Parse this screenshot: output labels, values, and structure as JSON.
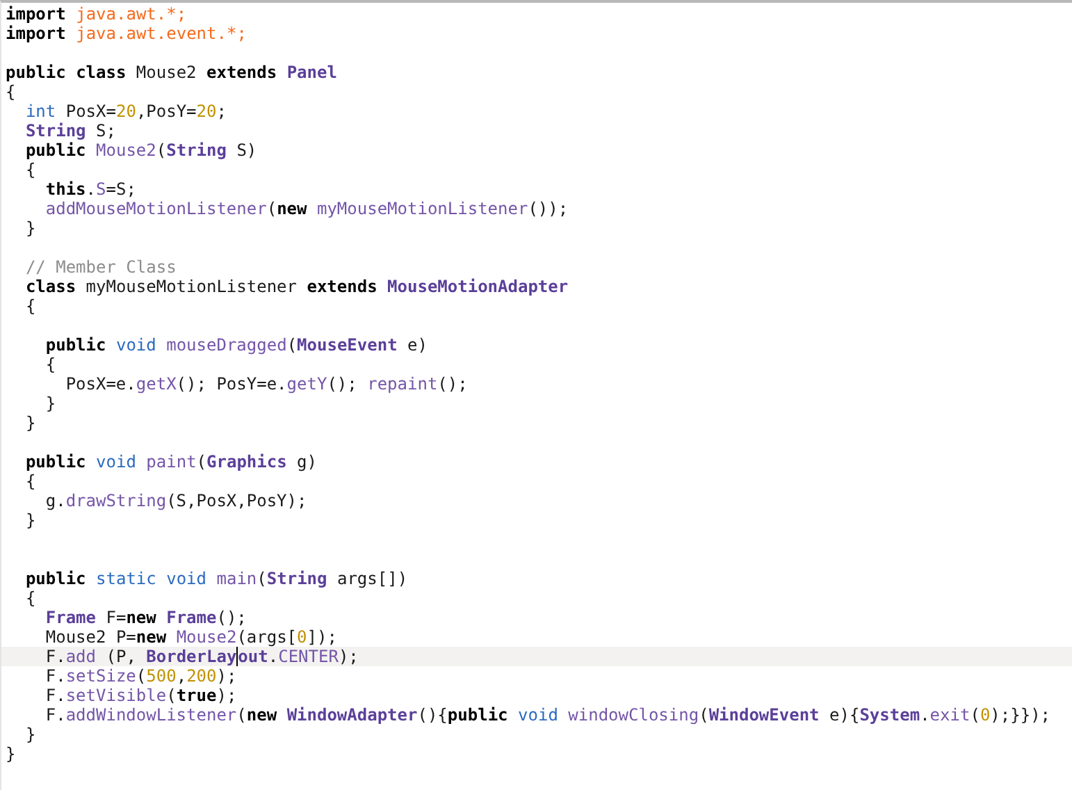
{
  "editor": {
    "lines": [
      {
        "kind": "code",
        "current": false,
        "tokens": [
          {
            "kind": "keyword",
            "text": "import"
          },
          {
            "kind": "space"
          },
          {
            "kind": "string",
            "text": "java.awt.*;"
          }
        ]
      },
      {
        "kind": "code",
        "current": false,
        "tokens": [
          {
            "kind": "keyword",
            "text": "import"
          },
          {
            "kind": "space"
          },
          {
            "kind": "string",
            "text": "java.awt.event.*;"
          }
        ]
      },
      {
        "kind": "blank",
        "current": false
      },
      {
        "kind": "code",
        "current": false,
        "tokens": [
          {
            "kind": "keyword",
            "text": "public class"
          },
          {
            "kind": "plain",
            "text": " Mouse2 "
          },
          {
            "kind": "keyword",
            "text": "extends"
          },
          {
            "kind": "space"
          },
          {
            "kind": "type",
            "text": "Panel"
          }
        ]
      },
      {
        "kind": "code",
        "current": false,
        "tokens": [
          {
            "kind": "plain",
            "text": "{"
          }
        ]
      },
      {
        "kind": "code",
        "current": false,
        "tokens": [
          {
            "kind": "indent"
          },
          {
            "kind": "primitive",
            "text": "int"
          },
          {
            "kind": "plain",
            "text": " PosX="
          },
          {
            "kind": "number",
            "text": "20"
          },
          {
            "kind": "plain",
            "text": ",PosY="
          },
          {
            "kind": "number",
            "text": "20"
          },
          {
            "kind": "plain",
            "text": ";"
          }
        ]
      },
      {
        "kind": "code",
        "current": false,
        "tokens": [
          {
            "kind": "indent"
          },
          {
            "kind": "type",
            "text": "String"
          },
          {
            "kind": "plain",
            "text": " S;"
          }
        ]
      },
      {
        "kind": "code",
        "current": false,
        "tokens": [
          {
            "kind": "indent"
          },
          {
            "kind": "keyword",
            "text": "public"
          },
          {
            "kind": "space"
          },
          {
            "kind": "function",
            "text": "Mouse2"
          },
          {
            "kind": "plain",
            "text": "("
          },
          {
            "kind": "type",
            "text": "String"
          },
          {
            "kind": "plain",
            "text": " S)"
          }
        ]
      },
      {
        "kind": "code",
        "current": false,
        "tokens": [
          {
            "kind": "indent"
          },
          {
            "kind": "plain",
            "text": "{"
          }
        ]
      },
      {
        "kind": "code",
        "current": false,
        "tokens": [
          {
            "kind": "indent"
          },
          {
            "kind": "indent"
          },
          {
            "kind": "keyword",
            "text": "this"
          },
          {
            "kind": "plain",
            "text": "."
          },
          {
            "kind": "function",
            "text": "S"
          },
          {
            "kind": "plain",
            "text": "=S;"
          }
        ]
      },
      {
        "kind": "code",
        "current": false,
        "tokens": [
          {
            "kind": "indent"
          },
          {
            "kind": "indent"
          },
          {
            "kind": "function",
            "text": "addMouseMotionListener"
          },
          {
            "kind": "plain",
            "text": "("
          },
          {
            "kind": "keyword",
            "text": "new"
          },
          {
            "kind": "space"
          },
          {
            "kind": "function",
            "text": "myMouseMotionListener"
          },
          {
            "kind": "plain",
            "text": "());"
          }
        ]
      },
      {
        "kind": "code",
        "current": false,
        "tokens": [
          {
            "kind": "indent"
          },
          {
            "kind": "plain",
            "text": "}"
          }
        ]
      },
      {
        "kind": "blank",
        "current": false
      },
      {
        "kind": "code",
        "current": false,
        "tokens": [
          {
            "kind": "indent"
          },
          {
            "kind": "comment",
            "text": "// Member Class"
          }
        ]
      },
      {
        "kind": "code",
        "current": false,
        "tokens": [
          {
            "kind": "indent"
          },
          {
            "kind": "keyword",
            "text": "class"
          },
          {
            "kind": "plain",
            "text": " myMouseMotionListener "
          },
          {
            "kind": "keyword",
            "text": "extends"
          },
          {
            "kind": "space"
          },
          {
            "kind": "type",
            "text": "MouseMotionAdapter"
          }
        ]
      },
      {
        "kind": "code",
        "current": false,
        "tokens": [
          {
            "kind": "indent"
          },
          {
            "kind": "plain",
            "text": "{"
          }
        ]
      },
      {
        "kind": "blank",
        "current": false
      },
      {
        "kind": "code",
        "current": false,
        "tokens": [
          {
            "kind": "indent"
          },
          {
            "kind": "indent"
          },
          {
            "kind": "keyword",
            "text": "public"
          },
          {
            "kind": "space"
          },
          {
            "kind": "primitive",
            "text": "void"
          },
          {
            "kind": "space"
          },
          {
            "kind": "function",
            "text": "mouseDragged"
          },
          {
            "kind": "plain",
            "text": "("
          },
          {
            "kind": "type",
            "text": "MouseEvent"
          },
          {
            "kind": "plain",
            "text": " e)"
          }
        ]
      },
      {
        "kind": "code",
        "current": false,
        "tokens": [
          {
            "kind": "indent"
          },
          {
            "kind": "indent"
          },
          {
            "kind": "plain",
            "text": "{"
          }
        ]
      },
      {
        "kind": "code",
        "current": false,
        "tokens": [
          {
            "kind": "indent"
          },
          {
            "kind": "indent"
          },
          {
            "kind": "indent"
          },
          {
            "kind": "plain",
            "text": "PosX=e."
          },
          {
            "kind": "function",
            "text": "getX"
          },
          {
            "kind": "plain",
            "text": "(); PosY=e."
          },
          {
            "kind": "function",
            "text": "getY"
          },
          {
            "kind": "plain",
            "text": "(); "
          },
          {
            "kind": "function",
            "text": "repaint"
          },
          {
            "kind": "plain",
            "text": "();"
          }
        ]
      },
      {
        "kind": "code",
        "current": false,
        "tokens": [
          {
            "kind": "indent"
          },
          {
            "kind": "indent"
          },
          {
            "kind": "plain",
            "text": "}"
          }
        ]
      },
      {
        "kind": "code",
        "current": false,
        "tokens": [
          {
            "kind": "indent"
          },
          {
            "kind": "plain",
            "text": "}"
          }
        ]
      },
      {
        "kind": "blank",
        "current": false
      },
      {
        "kind": "code",
        "current": false,
        "tokens": [
          {
            "kind": "indent"
          },
          {
            "kind": "keyword",
            "text": "public"
          },
          {
            "kind": "space"
          },
          {
            "kind": "primitive",
            "text": "void"
          },
          {
            "kind": "space"
          },
          {
            "kind": "function",
            "text": "paint"
          },
          {
            "kind": "plain",
            "text": "("
          },
          {
            "kind": "type",
            "text": "Graphics"
          },
          {
            "kind": "plain",
            "text": " g)"
          }
        ]
      },
      {
        "kind": "code",
        "current": false,
        "tokens": [
          {
            "kind": "indent"
          },
          {
            "kind": "plain",
            "text": "{"
          }
        ]
      },
      {
        "kind": "code",
        "current": false,
        "tokens": [
          {
            "kind": "indent"
          },
          {
            "kind": "indent"
          },
          {
            "kind": "plain",
            "text": "g."
          },
          {
            "kind": "function",
            "text": "drawString"
          },
          {
            "kind": "plain",
            "text": "(S,PosX,PosY);"
          }
        ]
      },
      {
        "kind": "code",
        "current": false,
        "tokens": [
          {
            "kind": "indent"
          },
          {
            "kind": "plain",
            "text": "}"
          }
        ]
      },
      {
        "kind": "blank",
        "current": false
      },
      {
        "kind": "blank",
        "current": false
      },
      {
        "kind": "code",
        "current": false,
        "tokens": [
          {
            "kind": "indent"
          },
          {
            "kind": "keyword",
            "text": "public"
          },
          {
            "kind": "space"
          },
          {
            "kind": "primitive",
            "text": "static void"
          },
          {
            "kind": "space"
          },
          {
            "kind": "function",
            "text": "main"
          },
          {
            "kind": "plain",
            "text": "("
          },
          {
            "kind": "type",
            "text": "String"
          },
          {
            "kind": "plain",
            "text": " args[])"
          }
        ]
      },
      {
        "kind": "code",
        "current": false,
        "tokens": [
          {
            "kind": "indent"
          },
          {
            "kind": "plain",
            "text": "{"
          }
        ]
      },
      {
        "kind": "code",
        "current": false,
        "tokens": [
          {
            "kind": "indent"
          },
          {
            "kind": "indent"
          },
          {
            "kind": "type",
            "text": "Frame"
          },
          {
            "kind": "plain",
            "text": " F="
          },
          {
            "kind": "keyword",
            "text": "new"
          },
          {
            "kind": "space"
          },
          {
            "kind": "type",
            "text": "Frame"
          },
          {
            "kind": "plain",
            "text": "();"
          }
        ]
      },
      {
        "kind": "code",
        "current": false,
        "tokens": [
          {
            "kind": "indent"
          },
          {
            "kind": "indent"
          },
          {
            "kind": "plain",
            "text": "Mouse2 P="
          },
          {
            "kind": "keyword",
            "text": "new"
          },
          {
            "kind": "space"
          },
          {
            "kind": "function",
            "text": "Mouse2"
          },
          {
            "kind": "plain",
            "text": "(args["
          },
          {
            "kind": "number",
            "text": "0"
          },
          {
            "kind": "plain",
            "text": "]);"
          }
        ]
      },
      {
        "kind": "code",
        "current": true,
        "tokens": [
          {
            "kind": "indent"
          },
          {
            "kind": "indent"
          },
          {
            "kind": "plain",
            "text": "F."
          },
          {
            "kind": "function",
            "text": "add"
          },
          {
            "kind": "plain",
            "text": " (P, "
          },
          {
            "kind": "type",
            "text": "BorderLay"
          },
          {
            "kind": "caret"
          },
          {
            "kind": "type",
            "text": "out"
          },
          {
            "kind": "plain",
            "text": "."
          },
          {
            "kind": "function",
            "text": "CENTER"
          },
          {
            "kind": "plain",
            "text": ");"
          }
        ]
      },
      {
        "kind": "code",
        "current": false,
        "tokens": [
          {
            "kind": "indent"
          },
          {
            "kind": "indent"
          },
          {
            "kind": "plain",
            "text": "F."
          },
          {
            "kind": "function",
            "text": "setSize"
          },
          {
            "kind": "plain",
            "text": "("
          },
          {
            "kind": "number",
            "text": "500"
          },
          {
            "kind": "plain",
            "text": ","
          },
          {
            "kind": "number",
            "text": "200"
          },
          {
            "kind": "plain",
            "text": ");"
          }
        ]
      },
      {
        "kind": "code",
        "current": false,
        "tokens": [
          {
            "kind": "indent"
          },
          {
            "kind": "indent"
          },
          {
            "kind": "plain",
            "text": "F."
          },
          {
            "kind": "function",
            "text": "setVisible"
          },
          {
            "kind": "plain",
            "text": "("
          },
          {
            "kind": "keyword",
            "text": "true"
          },
          {
            "kind": "plain",
            "text": ");"
          }
        ]
      },
      {
        "kind": "code",
        "current": false,
        "tokens": [
          {
            "kind": "indent"
          },
          {
            "kind": "indent"
          },
          {
            "kind": "plain",
            "text": "F."
          },
          {
            "kind": "function",
            "text": "addWindowListener"
          },
          {
            "kind": "plain",
            "text": "("
          },
          {
            "kind": "keyword",
            "text": "new"
          },
          {
            "kind": "space"
          },
          {
            "kind": "type",
            "text": "WindowAdapter"
          },
          {
            "kind": "plain",
            "text": "(){"
          },
          {
            "kind": "keyword",
            "text": "public"
          },
          {
            "kind": "space"
          },
          {
            "kind": "primitive",
            "text": "void"
          },
          {
            "kind": "space"
          },
          {
            "kind": "function",
            "text": "windowClosing"
          },
          {
            "kind": "plain",
            "text": "("
          },
          {
            "kind": "type",
            "text": "WindowEvent"
          },
          {
            "kind": "plain",
            "text": " e){"
          },
          {
            "kind": "type",
            "text": "System"
          },
          {
            "kind": "plain",
            "text": "."
          },
          {
            "kind": "function",
            "text": "exit"
          },
          {
            "kind": "plain",
            "text": "("
          },
          {
            "kind": "number",
            "text": "0"
          },
          {
            "kind": "plain",
            "text": ");}});"
          }
        ]
      },
      {
        "kind": "code",
        "current": false,
        "tokens": [
          {
            "kind": "indent"
          },
          {
            "kind": "plain",
            "text": "}"
          }
        ]
      },
      {
        "kind": "code",
        "current": false,
        "tokens": [
          {
            "kind": "plain",
            "text": "}"
          }
        ]
      }
    ]
  }
}
